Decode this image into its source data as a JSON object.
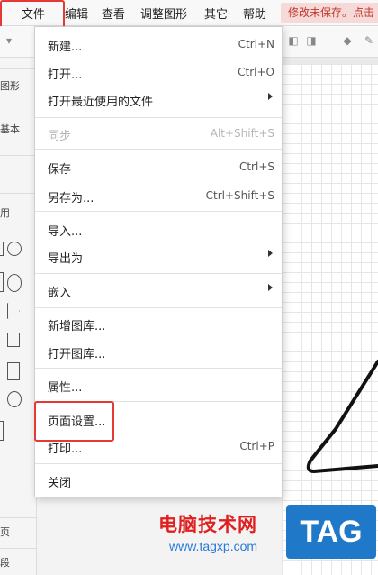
{
  "menubar": {
    "items": [
      {
        "label": "文件"
      },
      {
        "label": "编辑"
      },
      {
        "label": "查看"
      },
      {
        "label": "调整图形"
      },
      {
        "label": "其它"
      },
      {
        "label": "帮助"
      }
    ],
    "unsaved_notice": "修改未保存。点击"
  },
  "sidebar": {
    "search_placeholder": "图形",
    "section_basic": "基本",
    "section_general": "用",
    "bottom_1": "页",
    "bottom_2": "段"
  },
  "file_menu": {
    "items": [
      {
        "label": "新建...",
        "shortcut": "Ctrl+N"
      },
      {
        "label": "打开...",
        "shortcut": "Ctrl+O"
      },
      {
        "label": "打开最近使用的文件",
        "shortcut": ""
      },
      {
        "label": "同步",
        "shortcut": "Alt+Shift+S"
      },
      {
        "label": "保存",
        "shortcut": "Ctrl+S"
      },
      {
        "label": "另存为...",
        "shortcut": "Ctrl+Shift+S"
      },
      {
        "label": "导入...",
        "shortcut": ""
      },
      {
        "label": "导出为",
        "shortcut": ""
      },
      {
        "label": "嵌入",
        "shortcut": ""
      },
      {
        "label": "新增图库...",
        "shortcut": ""
      },
      {
        "label": "打开图库...",
        "shortcut": ""
      },
      {
        "label": "属性...",
        "shortcut": ""
      },
      {
        "label": "页面设置...",
        "shortcut": ""
      },
      {
        "label": "打印...",
        "shortcut": "Ctrl+P"
      },
      {
        "label": "关闭",
        "shortcut": ""
      }
    ]
  },
  "watermark": {
    "site_name": "电脑技术网",
    "url": "www.tagxp.com",
    "tag": "TAG"
  },
  "colors": {
    "highlight": "#e53935",
    "unsaved_bg": "#f6d9d9",
    "unsaved_text": "#c0392b"
  }
}
